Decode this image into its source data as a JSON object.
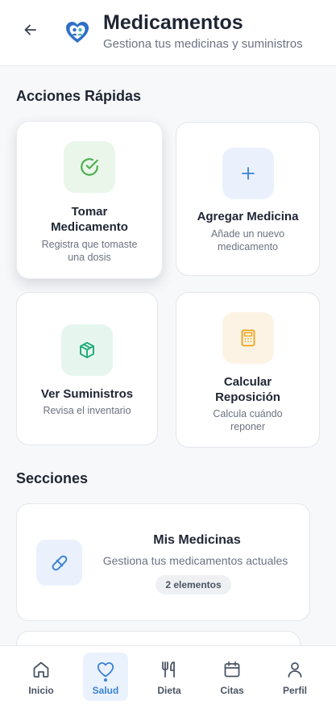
{
  "header": {
    "title": "Medicamentos",
    "subtitle": "Gestiona tus medicinas y suministros",
    "back_icon": "arrow-left-icon",
    "logo_icon": "heart-care-logo"
  },
  "quick_actions": {
    "title": "Acciones Rápidas",
    "cards": [
      {
        "title": "Tomar Medicamento",
        "description": "Registra que tomaste una dosis",
        "icon": "check-circle-icon",
        "accent": "#4caf50",
        "icon_bg": "#eaf6ea"
      },
      {
        "title": "Agregar Medicina",
        "description": "Añade un nuevo medicamento",
        "icon": "plus-icon",
        "accent": "#3b82d6",
        "icon_bg": "#eaf1fd"
      },
      {
        "title": "Ver Suministros",
        "description": "Revisa el inventario",
        "icon": "box-icon",
        "accent": "#1fa97a",
        "icon_bg": "#e6f6ef"
      },
      {
        "title": "Calcular Reposición",
        "description": "Calcula cuándo reponer",
        "icon": "calculator-icon",
        "accent": "#e7a21b",
        "icon_bg": "#fdf3e4"
      }
    ]
  },
  "sections": {
    "title": "Secciones",
    "items": [
      {
        "title": "Mis Medicinas",
        "description": "Gestiona tus medicamentos actuales",
        "badge": "2 elementos",
        "icon": "pill-icon",
        "accent": "#3b82d6"
      }
    ]
  },
  "bottom_nav": {
    "active": "Salud",
    "items": [
      {
        "label": "Inicio",
        "icon": "home-icon"
      },
      {
        "label": "Salud",
        "icon": "heart-icon"
      },
      {
        "label": "Dieta",
        "icon": "utensils-icon"
      },
      {
        "label": "Citas",
        "icon": "calendar-icon"
      },
      {
        "label": "Perfil",
        "icon": "user-icon"
      }
    ]
  }
}
